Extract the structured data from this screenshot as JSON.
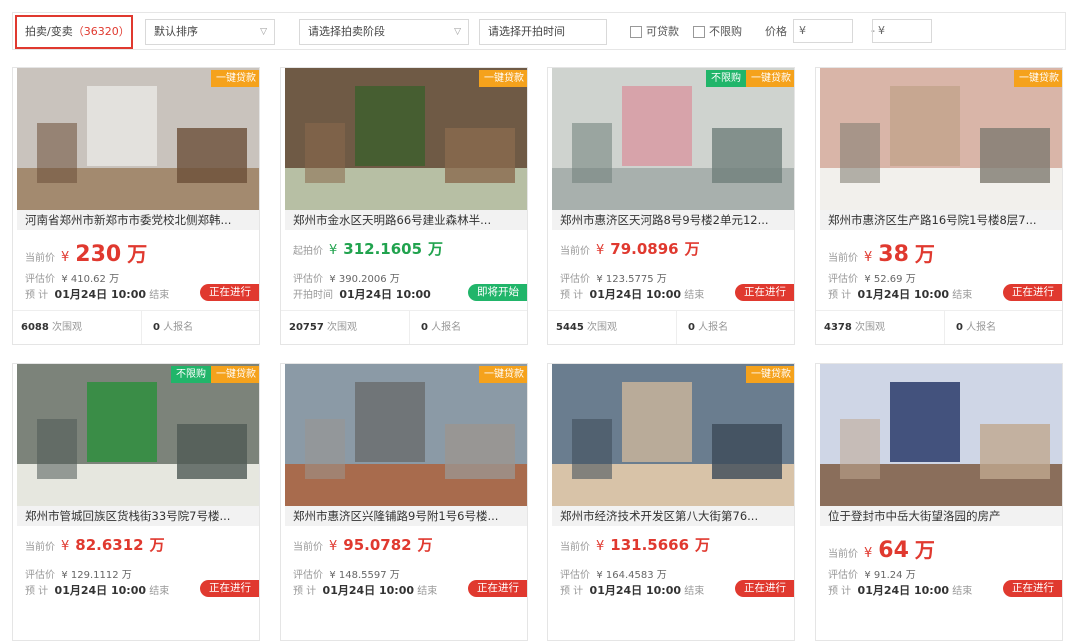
{
  "filters": {
    "tab_label": "拍卖/变卖",
    "tab_count": "（36320）",
    "sort": "默认排序",
    "stage": "请选择拍卖阶段",
    "time_placeholder": "请选择开拍时间",
    "loan": "可贷款",
    "unlimited": "不限购",
    "price_label": "价格",
    "price_min": "¥",
    "price_dash": "-",
    "price_max": "¥"
  },
  "listings": [
    {
      "title": "河南省郑州市新郑市市委党校北侧郑韩...",
      "tags": [
        "一键贷款"
      ],
      "price_label": "当前价",
      "price": "230",
      "unit": "万",
      "price_style": "big",
      "est_label": "评估价",
      "est": "¥ 410.62 万",
      "time_label": "预  计",
      "time": "01月24日 10:00",
      "time_suffix": "结束",
      "status": "正在进行",
      "status_color": "red",
      "views": "6088",
      "views_suffix": "次围观",
      "signups": "0",
      "signups_suffix": "人报名"
    },
    {
      "title": "郑州市金水区天明路66号建业森林半...",
      "tags": [
        "一键贷款"
      ],
      "price_label": "起拍价",
      "price": "312.1605",
      "unit": "万",
      "price_style": "med-green",
      "est_label": "评估价",
      "est": "¥ 390.2006 万",
      "time_label": "开拍时间",
      "time": "01月24日 10:00",
      "time_suffix": "",
      "status": "即将开始",
      "status_color": "green",
      "views": "20757",
      "views_suffix": "次围观",
      "signups": "0",
      "signups_suffix": "人报名"
    },
    {
      "title": "郑州市惠济区天河路8号9号楼2单元12...",
      "tags": [
        "不限购",
        "一键贷款"
      ],
      "price_label": "当前价",
      "price": "79.0896",
      "unit": "万",
      "price_style": "med",
      "est_label": "评估价",
      "est": "¥ 123.5775 万",
      "time_label": "预  计",
      "time": "01月24日 10:00",
      "time_suffix": "结束",
      "status": "正在进行",
      "status_color": "red",
      "views": "5445",
      "views_suffix": "次围观",
      "signups": "0",
      "signups_suffix": "人报名"
    },
    {
      "title": "郑州市惠济区生产路16号院1号楼8层7...",
      "tags": [
        "一键贷款"
      ],
      "price_label": "当前价",
      "price": "38",
      "unit": "万",
      "price_style": "big",
      "est_label": "评估价",
      "est": "¥ 52.69 万",
      "time_label": "预  计",
      "time": "01月24日 10:00",
      "time_suffix": "结束",
      "status": "正在进行",
      "status_color": "red",
      "views": "4378",
      "views_suffix": "次围观",
      "signups": "0",
      "signups_suffix": "人报名"
    },
    {
      "title": "郑州市管城回族区货栈街33号院7号楼...",
      "tags": [
        "不限购",
        "一键贷款"
      ],
      "price_label": "当前价",
      "price": "82.6312",
      "unit": "万",
      "price_style": "med",
      "est_label": "评估价",
      "est": "¥ 129.1112 万",
      "time_label": "预  计",
      "time": "01月24日 10:00",
      "time_suffix": "结束",
      "status": "正在进行",
      "status_color": "red",
      "views": "",
      "views_suffix": "",
      "signups": "",
      "signups_suffix": ""
    },
    {
      "title": "郑州市惠济区兴隆铺路9号附1号6号楼...",
      "tags": [
        "一键贷款"
      ],
      "price_label": "当前价",
      "price": "95.0782",
      "unit": "万",
      "price_style": "med",
      "est_label": "评估价",
      "est": "¥ 148.5597 万",
      "time_label": "预  计",
      "time": "01月24日 10:00",
      "time_suffix": "结束",
      "status": "正在进行",
      "status_color": "red",
      "views": "",
      "views_suffix": "",
      "signups": "",
      "signups_suffix": ""
    },
    {
      "title": "郑州市经济技术开发区第八大街第76...",
      "tags": [
        "一键贷款"
      ],
      "price_label": "当前价",
      "price": "131.5666",
      "unit": "万",
      "price_style": "med",
      "est_label": "评估价",
      "est": "¥ 164.4583 万",
      "time_label": "预  计",
      "time": "01月24日 10:00",
      "time_suffix": "结束",
      "status": "正在进行",
      "status_color": "red",
      "views": "",
      "views_suffix": "",
      "signups": "",
      "signups_suffix": ""
    },
    {
      "title": "位于登封市中岳大街望洛园的房产",
      "tags": [],
      "price_label": "当前价",
      "price": "64",
      "unit": "万",
      "price_style": "big",
      "est_label": "评估价",
      "est": "¥ 91.24 万",
      "time_label": "预  计",
      "time": "01月24日 10:00",
      "time_suffix": "结束",
      "status": "正在进行",
      "status_color": "red",
      "views": "",
      "views_suffix": "",
      "signups": "",
      "signups_suffix": ""
    }
  ],
  "colors": {
    "accent_red": "#e0392f",
    "tag_orange": "#f5a21c",
    "tag_green": "#21b56a"
  }
}
